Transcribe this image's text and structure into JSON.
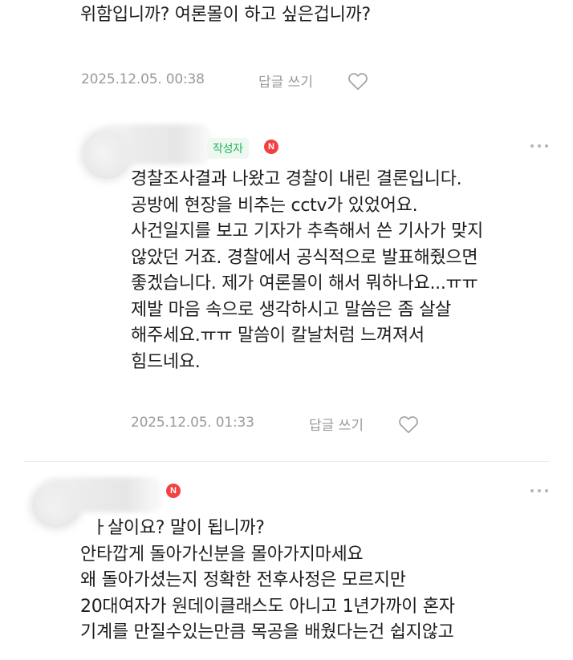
{
  "comment1": {
    "text_tail": "위함입니까? 여론몰이 하고 싶은겁니까?",
    "date": "2025.12.05. 00:38",
    "reply_label": "답글 쓰기"
  },
  "comment2": {
    "author_badge": "작성자",
    "n_badge": "N",
    "lines": [
      "경찰조사결과 나왔고 경찰이 내린 결론입니다.",
      "공방에 현장을 비추는 cctv가 있었어요.",
      "사건일지를 보고 기자가 추측해서 쓴 기사가 맞지",
      "않았던 거죠. 경찰에서 공식적으로 발표해줬으면",
      "좋겠습니다. 제가 여론몰이 해서 뭐하나요...ㅠㅠ",
      "제발 마음 속으로 생각하시고 말씀은 좀 살살",
      "해주세요.ㅠㅠ 말씀이 칼날처럼 느껴져서",
      "힘드네요."
    ],
    "date": "2025.12.05. 01:33",
    "reply_label": "답글 쓰기"
  },
  "comment3": {
    "n_badge": "N",
    "lines": [
      "ㅏ살이요? 말이 됩니까?",
      "안타깝게 돌아가신분을 몰아가지마세요",
      "왜 돌아가셨는지 정확한 전후사정은 모르지만",
      "20대여자가 원데이클래스도 아니고 1년가까이 혼자",
      "기계를 만질수있는만큼 목공을 배웠다는건 쉽지않고"
    ]
  },
  "icons": {
    "like": "heart-outline-icon",
    "more": "more-dots-icon"
  }
}
